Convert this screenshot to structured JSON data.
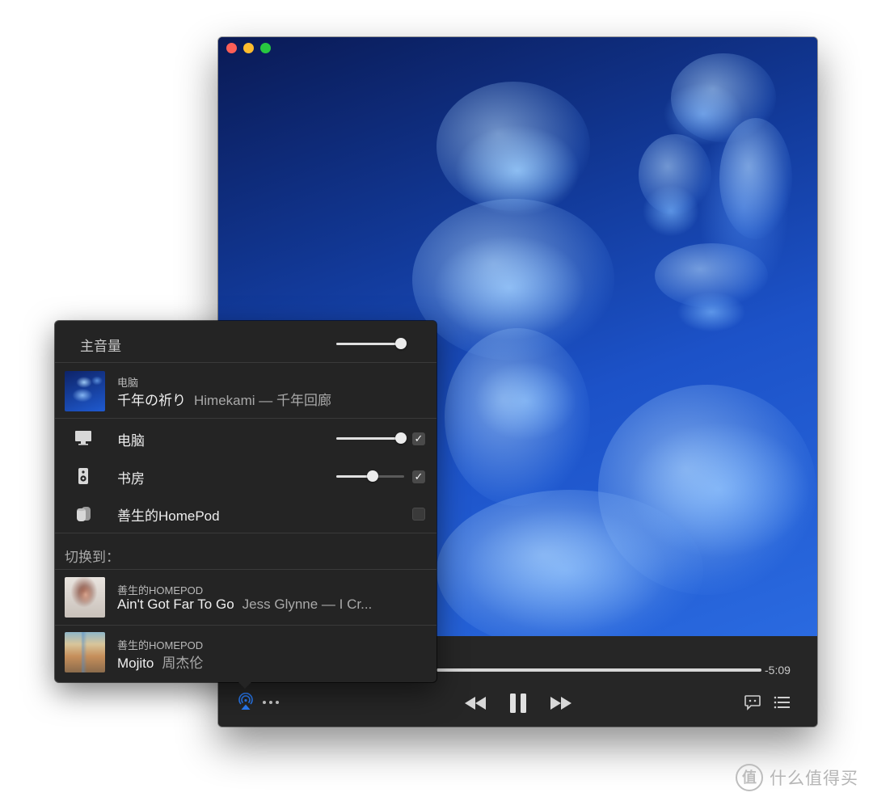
{
  "window": {
    "time_remaining": "-5:09",
    "progress_fraction": 0.78,
    "icons": [
      "airplay-icon",
      "more-icon",
      "rewind-icon",
      "pause-icon",
      "fast-forward-icon",
      "lyrics-icon",
      "queue-icon"
    ]
  },
  "popover": {
    "master_volume_label": "主音量",
    "master_volume": 1.0,
    "now_playing": {
      "source": "电脑",
      "title": "千年の祈り",
      "artist": "Himekami — 千年回廊"
    },
    "devices": [
      {
        "name": "电脑",
        "icon": "computer-icon",
        "volume": 1.0,
        "checked": true,
        "check_mark": "✓"
      },
      {
        "name": "书房",
        "icon": "speaker-icon",
        "volume": 0.54,
        "checked": true,
        "check_mark": "✓"
      },
      {
        "name": "善生的HomePod",
        "icon": "homepod-icon",
        "checked": false
      }
    ],
    "switch_to_label": "切换到：",
    "switch_items": [
      {
        "source": "善生的HOMEPOD",
        "title": "Ain't Got Far To Go",
        "artist": "Jess Glynne — I Cr..."
      },
      {
        "source": "善生的HOMEPOD",
        "title": "Mojito",
        "artist": "周杰伦"
      }
    ]
  },
  "watermark": {
    "logo_char": "值",
    "text": "什么值得买"
  },
  "colors": {
    "window_bg": "#262626",
    "popover_bg": "#242424",
    "airplay_accent": "#2a7cf6",
    "close": "#fd5f57",
    "minimize": "#febc2e",
    "maximize": "#28c840"
  }
}
